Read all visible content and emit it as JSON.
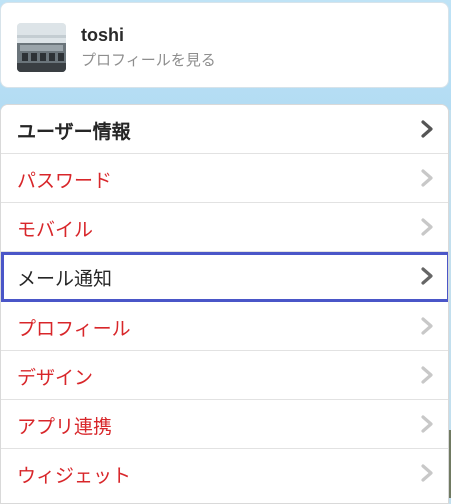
{
  "profile": {
    "name": "toshi",
    "view_profile": "プロフィールを見る"
  },
  "menu": {
    "items": [
      {
        "label": "ユーザー情報",
        "style": "header",
        "chevron_color": "#555555"
      },
      {
        "label": "パスワード",
        "style": "normal",
        "chevron_color": "#c8c8c8"
      },
      {
        "label": "モバイル",
        "style": "normal",
        "chevron_color": "#c8c8c8"
      },
      {
        "label": "メール通知",
        "style": "active",
        "chevron_color": "#666666"
      },
      {
        "label": "プロフィール",
        "style": "normal",
        "chevron_color": "#c8c8c8"
      },
      {
        "label": "デザイン",
        "style": "normal",
        "chevron_color": "#c8c8c8"
      },
      {
        "label": "アプリ連携",
        "style": "normal",
        "chevron_color": "#c8c8c8"
      },
      {
        "label": "ウィジェット",
        "style": "normal",
        "chevron_color": "#c8c8c8"
      }
    ]
  },
  "colors": {
    "link_red": "#d8262a",
    "selection_border": "#4a56c8",
    "background_blue": "#bfe3f6"
  }
}
